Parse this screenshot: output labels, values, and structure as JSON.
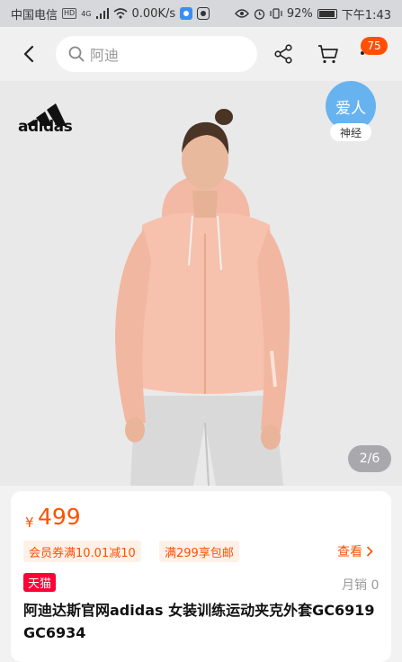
{
  "status_bar": {
    "carrier": "中国电信",
    "hd": "HD",
    "network": "4G",
    "speed": "0.00K/s",
    "battery": "92%",
    "time": "下午1:43"
  },
  "topnav": {
    "search_placeholder": "阿迪",
    "cart_count": "75"
  },
  "hero": {
    "logo_text": "adidas",
    "brand_badge": "爱人",
    "brand_tag": "神经",
    "page_indicator": "2/6"
  },
  "product": {
    "currency": "¥",
    "price": "499",
    "coupon_member": "会员券满10.01减10",
    "coupon_shipping": "满299享包邮",
    "view_more": "查看",
    "store_badge": "天猫",
    "monthly_sales": "月销 0",
    "title": "阿迪达斯官网adidas 女装训练运动夹克外套GC6919 GC6934"
  },
  "colors": {
    "accent": "#ff5000",
    "tmall_red": "#ff0036",
    "badge_blue": "#67b3f0",
    "jacket_pink": "#f6c2ad"
  }
}
